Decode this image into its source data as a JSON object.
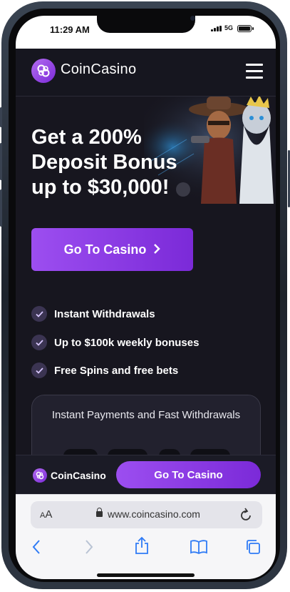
{
  "status_bar": {
    "time": "11:29 AM",
    "network": "5G"
  },
  "header": {
    "brand": "CoinCasino",
    "menu_icon": "hamburger-menu-icon"
  },
  "hero": {
    "headline": "Get a 200% Deposit Bonus up to $30,000!",
    "cta_label": "Go To Casino",
    "features": [
      {
        "label": "Instant Withdrawals"
      },
      {
        "label": "Up to $100k weekly bonuses"
      },
      {
        "label": "Free Spins and free bets"
      }
    ]
  },
  "card": {
    "title": "Instant Payments and Fast Withdrawals"
  },
  "sticky_bar": {
    "brand": "CoinCasino",
    "cta_label": "Go To Casino"
  },
  "browser": {
    "aa": "A",
    "aa_small": "A",
    "url": "www.coincasino.com"
  },
  "colors": {
    "accent": "#8b3fe6",
    "background": "#17161f",
    "text": "#ffffff"
  }
}
